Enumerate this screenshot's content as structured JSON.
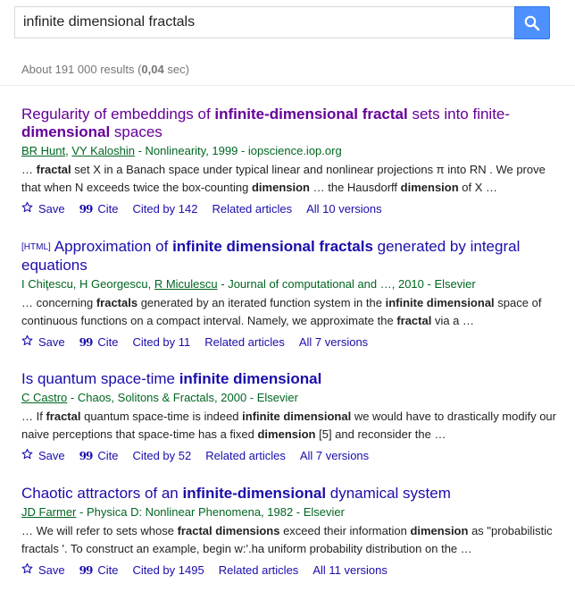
{
  "search": {
    "query": "infinite dimensional fractals"
  },
  "stats": {
    "count_prefix": "About 191 000 results (",
    "time": "0,04",
    "time_suffix": " sec)"
  },
  "results": [
    {
      "visited": true,
      "tag": "",
      "title_parts": [
        [
          "Regularity of embeddings of ",
          false
        ],
        [
          "infinite-dimensional fractal",
          true
        ],
        [
          " sets into finite-",
          false
        ],
        [
          "dimensional",
          true
        ],
        [
          " spaces",
          false
        ]
      ],
      "authors": [
        [
          "BR Hunt",
          true
        ],
        [
          ", ",
          false
        ],
        [
          "VY Kaloshin",
          true
        ]
      ],
      "source": " - Nonlinearity, 1999 - iopscience.iop.org",
      "snippet_parts": [
        [
          "… ",
          false
        ],
        [
          "fractal",
          true
        ],
        [
          " set X in a Banach space under typical linear and nonlinear projections π into RN . We prove that when N exceeds twice the box-counting ",
          false
        ],
        [
          "dimension",
          true
        ],
        [
          " … the Hausdorff ",
          false
        ],
        [
          "dimension",
          true
        ],
        [
          " of X …",
          false
        ]
      ],
      "actions": {
        "save": "Save",
        "cite": "Cite",
        "cited_by": "Cited by 142",
        "related": "Related articles",
        "versions": "All 10 versions"
      }
    },
    {
      "visited": false,
      "tag": "[HTML]",
      "title_parts": [
        [
          "Approximation of ",
          false
        ],
        [
          "infinite dimensional fractals",
          true
        ],
        [
          " generated by integral equations",
          false
        ]
      ],
      "authors": [
        [
          "I Chiţescu, H Georgescu, ",
          false
        ],
        [
          "R Miculescu",
          true
        ]
      ],
      "source": " - Journal of computational and …, 2010 - Elsevier",
      "snippet_parts": [
        [
          "… concerning ",
          false
        ],
        [
          "fractals",
          true
        ],
        [
          " generated by an iterated function system in the ",
          false
        ],
        [
          "infinite dimensional",
          true
        ],
        [
          " space of continuous functions on a compact interval. Namely, we approximate the ",
          false
        ],
        [
          "fractal",
          true
        ],
        [
          " via a …",
          false
        ]
      ],
      "actions": {
        "save": "Save",
        "cite": "Cite",
        "cited_by": "Cited by 11",
        "related": "Related articles",
        "versions": "All 7 versions"
      }
    },
    {
      "visited": false,
      "tag": "",
      "title_parts": [
        [
          "Is quantum space-time ",
          false
        ],
        [
          "infinite dimensional",
          true
        ]
      ],
      "authors": [
        [
          "C Castro",
          true
        ]
      ],
      "source": " - Chaos, Solitons & Fractals, 2000 - Elsevier",
      "snippet_parts": [
        [
          "… If ",
          false
        ],
        [
          "fractal",
          true
        ],
        [
          " quantum space-time is indeed ",
          false
        ],
        [
          "infinite dimensional",
          true
        ],
        [
          " we would have to drastically modify our naive perceptions that space-time has a fixed ",
          false
        ],
        [
          "dimension",
          true
        ],
        [
          " [5] and reconsider the …",
          false
        ]
      ],
      "actions": {
        "save": "Save",
        "cite": "Cite",
        "cited_by": "Cited by 52",
        "related": "Related articles",
        "versions": "All 7 versions"
      }
    },
    {
      "visited": false,
      "tag": "",
      "title_parts": [
        [
          "Chaotic attractors of an ",
          false
        ],
        [
          "infinite-dimensional",
          true
        ],
        [
          " dynamical system",
          false
        ]
      ],
      "authors": [
        [
          "JD Farmer",
          true
        ]
      ],
      "source": " - Physica D: Nonlinear Phenomena, 1982 - Elsevier",
      "snippet_parts": [
        [
          "… We will refer to sets whose ",
          false
        ],
        [
          "fractal dimensions",
          true
        ],
        [
          " exceed their information ",
          false
        ],
        [
          "dimension",
          true
        ],
        [
          " as \"probabilistic fractals '. To construct an example, begin w:'.ha uniform probability distribution on the …",
          false
        ]
      ],
      "actions": {
        "save": "Save",
        "cite": "Cite",
        "cited_by": "Cited by 1495",
        "related": "Related articles",
        "versions": "All 11 versions"
      }
    }
  ]
}
